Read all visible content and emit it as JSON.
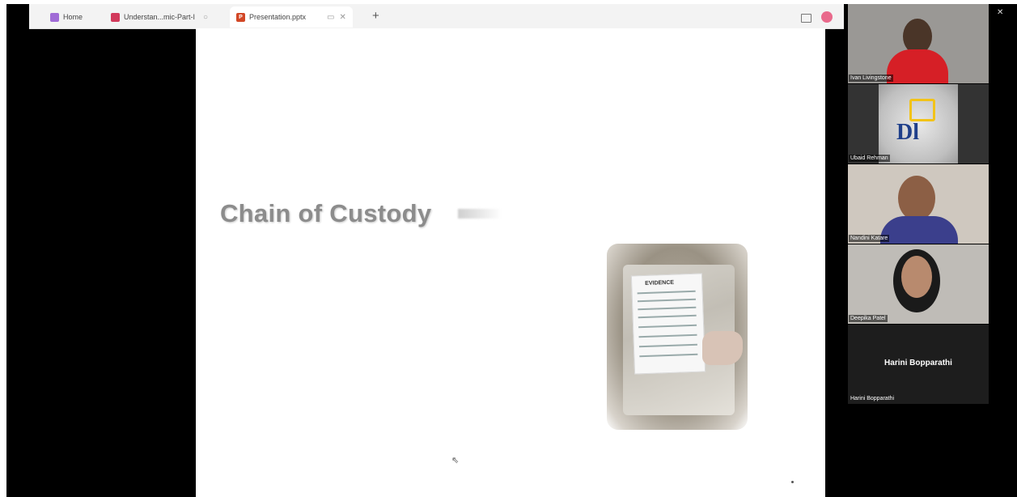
{
  "browser": {
    "tabs": [
      {
        "label": "Home",
        "favicon_color": "#a06bd6"
      },
      {
        "label": "Understan...mic-Part-I",
        "favicon_color": "#d23a5b"
      },
      {
        "label": "Presentation.pptx",
        "favicon_color": "#d24726"
      }
    ],
    "plus": "+",
    "icons": [
      "reading-view-icon",
      "profile-avatar-icon"
    ]
  },
  "slide": {
    "title": "Chain of Custody",
    "photo_label": "EVIDENCE"
  },
  "window_controls": {
    "minimize": "–",
    "restore": "❐",
    "close": "✕"
  },
  "participants": [
    {
      "name": "Ivan Livingstone",
      "video_bg": "#9a9895",
      "accent": "#d61f26"
    },
    {
      "name": "Ubaid Rehman",
      "video_bg": "#333333",
      "accent": "#f2c318"
    },
    {
      "name": "Nandini Katare",
      "video_bg": "#cfc8bf",
      "accent": "#3b3f8c"
    },
    {
      "name": "Deepika Patel",
      "video_bg": "#bfbcb7",
      "accent": "#1a1a1a"
    },
    {
      "name": "Harini Bopparathi",
      "display_name": "Harini Bopparathi",
      "video_bg": "#1d1d1d"
    }
  ]
}
